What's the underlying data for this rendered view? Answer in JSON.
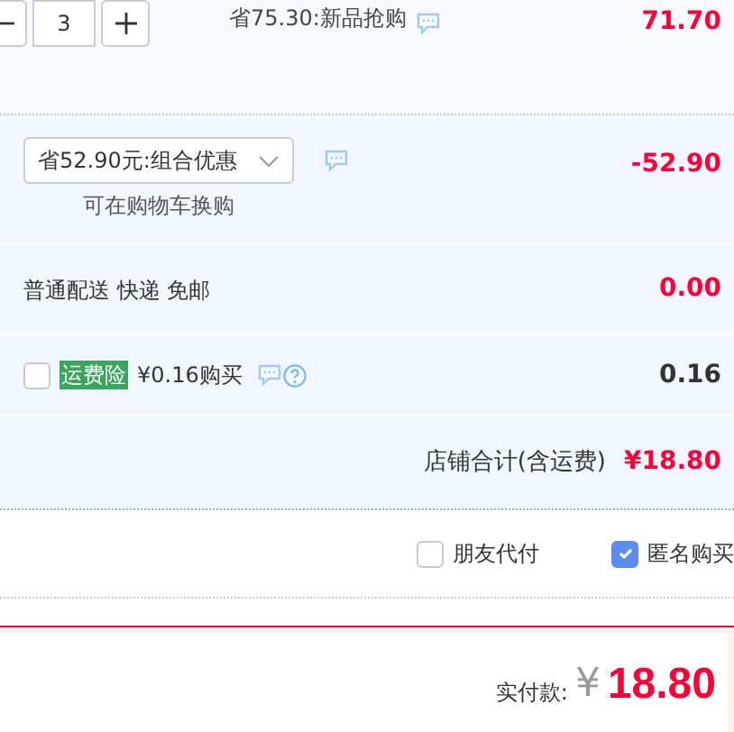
{
  "item": {
    "quantity": "3",
    "promo": "省75.30:新品抢购",
    "price": "71.70"
  },
  "discount": {
    "selected": "省52.90元:组合优惠",
    "note": "可在购物车换购",
    "amount": "-52.90"
  },
  "shipping": {
    "label": "普通配送 快递 免邮",
    "amount": "0.00"
  },
  "insurance": {
    "checked": false,
    "badge": "运费险",
    "label": "¥0.16购买",
    "amount": "0.16"
  },
  "shop_total": {
    "label": "店铺合计(含运费)",
    "amount": "¥18.80"
  },
  "options": [
    {
      "label": "朋友代付",
      "checked": false
    },
    {
      "label": "匿名购买",
      "checked": true
    }
  ],
  "payment": {
    "label": "实付款:",
    "currency": "¥",
    "amount": "18.80"
  }
}
